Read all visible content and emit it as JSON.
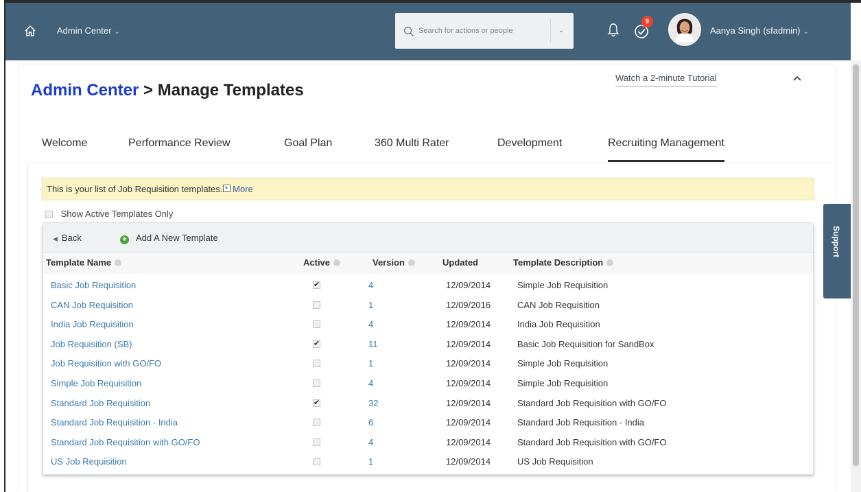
{
  "header": {
    "app_title": "Admin Center",
    "search_placeholder": "Search for actions or people",
    "todo_badge": "9",
    "user_name": "Aanya Singh (sfadmin)"
  },
  "page": {
    "breadcrumb_link": "Admin Center",
    "breadcrumb_sep": " > ",
    "breadcrumb_current": "Manage Templates",
    "tutorial_link": "Watch a 2-minute Tutorial"
  },
  "tabs": [
    {
      "label": "Welcome",
      "active": false
    },
    {
      "label": "Performance Review",
      "active": false
    },
    {
      "label": "Goal Plan",
      "active": false
    },
    {
      "label": "360 Multi Rater",
      "active": false
    },
    {
      "label": "Development",
      "active": false
    },
    {
      "label": "Recruiting Management",
      "active": true
    }
  ],
  "info_bar": {
    "text": "This is your list of Job Requisition templates.",
    "more_icon": "+",
    "more_label": "More"
  },
  "filter": {
    "active_only_label": "Show Active Templates Only"
  },
  "toolbar": {
    "back_label": "Back",
    "add_label": "Add A New Template"
  },
  "table": {
    "columns": [
      "Template Name",
      "Active",
      "Version",
      "Updated",
      "Template Description"
    ],
    "rows": [
      {
        "name": "Basic Job Requisition",
        "active": true,
        "version": "4",
        "updated": "12/09/2014",
        "description": "Simple Job Requisition"
      },
      {
        "name": "CAN Job Requisition",
        "active": false,
        "version": "1",
        "updated": "12/09/2016",
        "description": "CAN Job Requisition"
      },
      {
        "name": "India Job Requisition",
        "active": false,
        "version": "4",
        "updated": "12/09/2014",
        "description": "India Job Requisition"
      },
      {
        "name": "Job Requisition (SB)",
        "active": true,
        "version": "11",
        "updated": "12/09/2014",
        "description": "Basic Job Requisition for SandBox"
      },
      {
        "name": "Job Requisition with GO/FO",
        "active": false,
        "version": "1",
        "updated": "12/09/2014",
        "description": "Simple Job Requisition"
      },
      {
        "name": "Simple Job Requisition",
        "active": false,
        "version": "4",
        "updated": "12/09/2014",
        "description": "Simple Job Requisition"
      },
      {
        "name": "Standard Job Requisition",
        "active": true,
        "version": "32",
        "updated": "12/09/2014",
        "description": "Standard Job Requisition with GO/FO"
      },
      {
        "name": "Standard Job Requisition - India",
        "active": false,
        "version": "6",
        "updated": "12/09/2014",
        "description": "Standard Job Requisition - India"
      },
      {
        "name": "Standard Job Requisition with GO/FO",
        "active": false,
        "version": "4",
        "updated": "12/09/2014",
        "description": "Standard Job Requisition with GO/FO"
      },
      {
        "name": "US Job Requisition",
        "active": false,
        "version": "1",
        "updated": "12/09/2014",
        "description": "US Job Requisition"
      }
    ]
  },
  "support": {
    "label": "Support"
  },
  "colors": {
    "header_bg": "#43627a",
    "link": "#3a79ad",
    "breadcrumb_link": "#1a3bcf",
    "info_bg": "#fbf4c6",
    "add_icon": "#4aa83a",
    "badge": "#e8452c"
  }
}
